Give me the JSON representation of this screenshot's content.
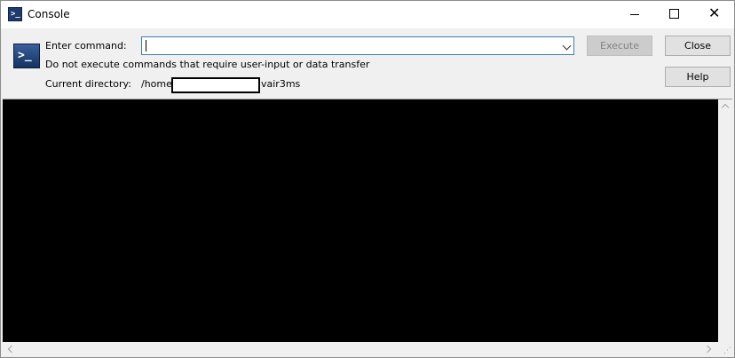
{
  "window": {
    "title": "Console"
  },
  "header": {
    "enter_command_label": "Enter command:",
    "command_value": "",
    "warning_text": "Do not execute commands that require user-input or data transfer",
    "current_directory_label": "Current directory:",
    "current_directory_prefix": "/home/",
    "current_directory_suffix": "vair3ms"
  },
  "buttons": {
    "execute": "Execute",
    "close": "Close",
    "help": "Help"
  },
  "icons": {
    "app": "console-prompt-icon",
    "minimize": "minimize-icon",
    "maximize": "maximize-icon",
    "close": "close-icon"
  },
  "colors": {
    "console_background": "#000000",
    "input_border": "#3c7fb1"
  }
}
